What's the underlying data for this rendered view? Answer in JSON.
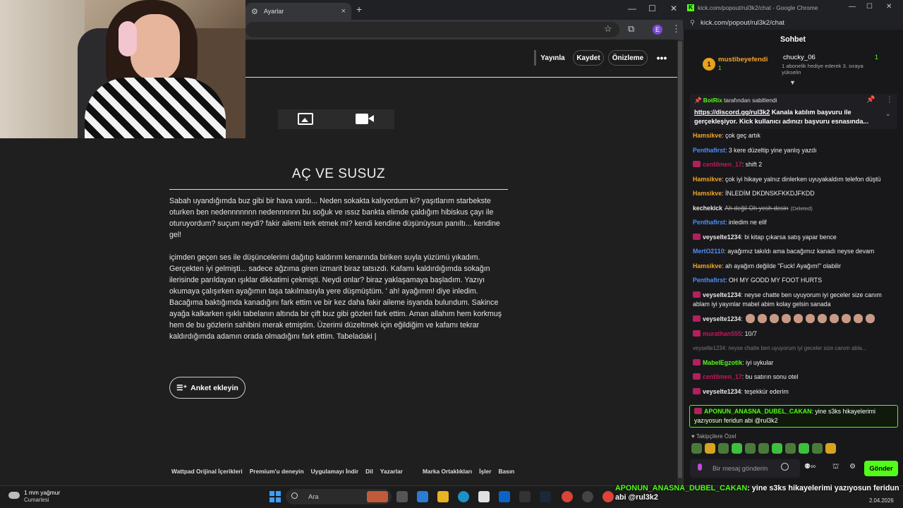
{
  "left_browser": {
    "tab_title": "Ayarlar",
    "avatar_letter": "E"
  },
  "wattpad": {
    "buttons": {
      "publish": "Yayınla",
      "save": "Kaydet",
      "preview": "Önizleme",
      "more": "•••"
    },
    "story_title": "AÇ VE SUSUZ",
    "paragraph1": "Sabah uyandığımda buz gibi bir hava vardı... Neden sokakta kalıyordum ki? yaşıtlarım starbekste oturken ben nedennnnnnn nedennnnnn bu soğuk ve ıssız bankta elimde çaldığım hibiskus çayı ile oturuyordum? suçum neydi? fakir ailemi terk etmek mi? kendi kendine düşünüysun panıltı... kendine gel!",
    "paragraph2": "içimden geçen ses ile düşüncelerimi dağıtıp kaldırım kenarında biriken suyla yüzümü yıkadım. Gerçekten iyi gelmişti... sadece ağzıma giren izmarit biraz tatsızdı. Kafamı kaldırdığımda sokağın ilerisinde parıldayan ışıklar dikkatimi çekmişti. Neydi onlar? biraz yaklaşamaya başladım. Yazıyı okumaya çalışırken ayağımın taşa takılmasıyla yere düşmüştüm. ' ah! ayağımm! diye inledim. Bacağıma baktığımda kanadığını fark ettim ve bir kez daha fakir aileme isyanda bulundum. Sakince ayağa kalkarken ışıklı tabelanın altında bir çift buz gibi gözleri fark ettim. Aman allahım hem korkmuş hem de bu gözlerin sahibini merak etmiştim. Üzerimi düzeltmek için eğildiğim ve kafamı tekrar kaldırdığımda adamın orada olmadığını fark ettim. Tabeladaki |",
    "poll_button": "Anket ekleyin",
    "footer_links": [
      "Wattpad Orijinal İçerikleri",
      "Premium'u deneyin",
      "Uygulamayı İndir",
      "Dil",
      "Yazarlar",
      "Marka Ortaklıkları",
      "İşler",
      "Basın"
    ]
  },
  "chat_window": {
    "window_title": "kick.com/popout/rul3k2/chat - Google Chrome",
    "url": "kick.com/popout/rul3k2/chat",
    "header": "Sohbet",
    "gifters": {
      "first": {
        "rank": "1",
        "name": "mustibeyefendi",
        "count": "1"
      },
      "second": {
        "name": "chucky_06",
        "count": "1",
        "sub": "1 abonelik hediye ederek 3. sıraya yükselin"
      }
    },
    "pinned": {
      "pinned_by_name": "BotRix",
      "pinned_by_text": "tarafından sabitlendi",
      "link": "https://discord.gg/rul3k2",
      "text": " Kanala katılım başvuru ile gerçekleşiyor. Kick kullanıcı adınızı başvuru esnasında..."
    },
    "messages": [
      {
        "user": "Hamsikve",
        "color": "#f5a524",
        "text": ": çok geç artık",
        "badge": false
      },
      {
        "user": "Penthafirst",
        "color": "#4f8ef7",
        "text": ": 3 kere düzeltip yine yanlış yazdı",
        "badge": false
      },
      {
        "user": "centilmen_17",
        "color": "#c2185b",
        "text": ": shift 2",
        "badge": true
      },
      {
        "user": "Hamsikve",
        "color": "#f5a524",
        "text": ": çok iyi hikaye yalnız dinlerken uyuyakaldım telefon düştü",
        "badge": false
      },
      {
        "user": "Hamsikve",
        "color": "#f5a524",
        "text": ": İNLEDİM DKDNSKFKKDJFKDD",
        "badge": false
      },
      {
        "user": "kechekick",
        "color": "#e8e8e8",
        "text": "Ah değil Oh yesh desin",
        "deleted": "(Deleted)",
        "badge": false
      },
      {
        "user": "Penthafirst",
        "color": "#4f8ef7",
        "text": ": inledim ne elif",
        "badge": false
      },
      {
        "user": "veyselte1234",
        "color": "#e8e8e8",
        "text": ": bi kitap çıkarsa satış yapar bence",
        "badge": true
      },
      {
        "user": "MertO2110",
        "color": "#4f8ef7",
        "text": ": ayağımız takıldı ama bacağımız kanadı neyse devam",
        "badge": false
      },
      {
        "user": "Hamsikve",
        "color": "#f5a524",
        "text": ": ah ayağım değilde \"Fuck! Ayağım!\" olabilir",
        "badge": false
      },
      {
        "user": "Penthafirst",
        "color": "#4f8ef7",
        "text": ": OH MY GODD MY FOOT HURTS",
        "badge": false
      },
      {
        "user": "veyselte1234",
        "color": "#e8e8e8",
        "text": ": neyse chatte ben uyuyorum iyi geceler size canım ablam iyi yayınlar mabel abim kolay gelsin sanada",
        "badge": true
      },
      {
        "user": "veyselte1234",
        "color": "#e8e8e8",
        "text": ":",
        "emotes": true,
        "badge": true
      },
      {
        "user": "murathan555",
        "color": "#c2185b",
        "text": ": 10/7",
        "badge": true
      },
      {
        "faded": "veyselte1234: neyse chatte ben uyuyorum iyi geceler size canım abla..."
      },
      {
        "user": "MabelEgzotik",
        "color": "#53fc18",
        "text": ": iyi uykular",
        "badge": true
      },
      {
        "user": "centilmen_17",
        "color": "#c2185b",
        "text": ": bu satırın sonu otel",
        "badge": true
      },
      {
        "user": "veyselte1234",
        "color": "#e8e8e8",
        "text": ": teşekkür ederim",
        "badge": true
      }
    ],
    "highlight": {
      "user": "APONUN_ANASNA_DUBEL_CAKAN",
      "text": ": yine s3ks hikayelerimi yazıyosun feridun abi @rul3k2"
    },
    "followers_only": "Takipçilere Özel",
    "input_placeholder": "Bir mesaj gönderin",
    "send_button": "Gönder"
  },
  "overlay_alert": {
    "user": "APONUN_ANASNA_DUBEL_CAKAN",
    "text": ": yine s3ks hikayelerimi yazıyosun feridun",
    "line2": "abi @rul3k2"
  },
  "taskbar": {
    "weather_temp": "1 mm yağmur",
    "weather_desc": "Cumartesi",
    "search_placeholder": "Ara",
    "date": "2.04.2026"
  }
}
